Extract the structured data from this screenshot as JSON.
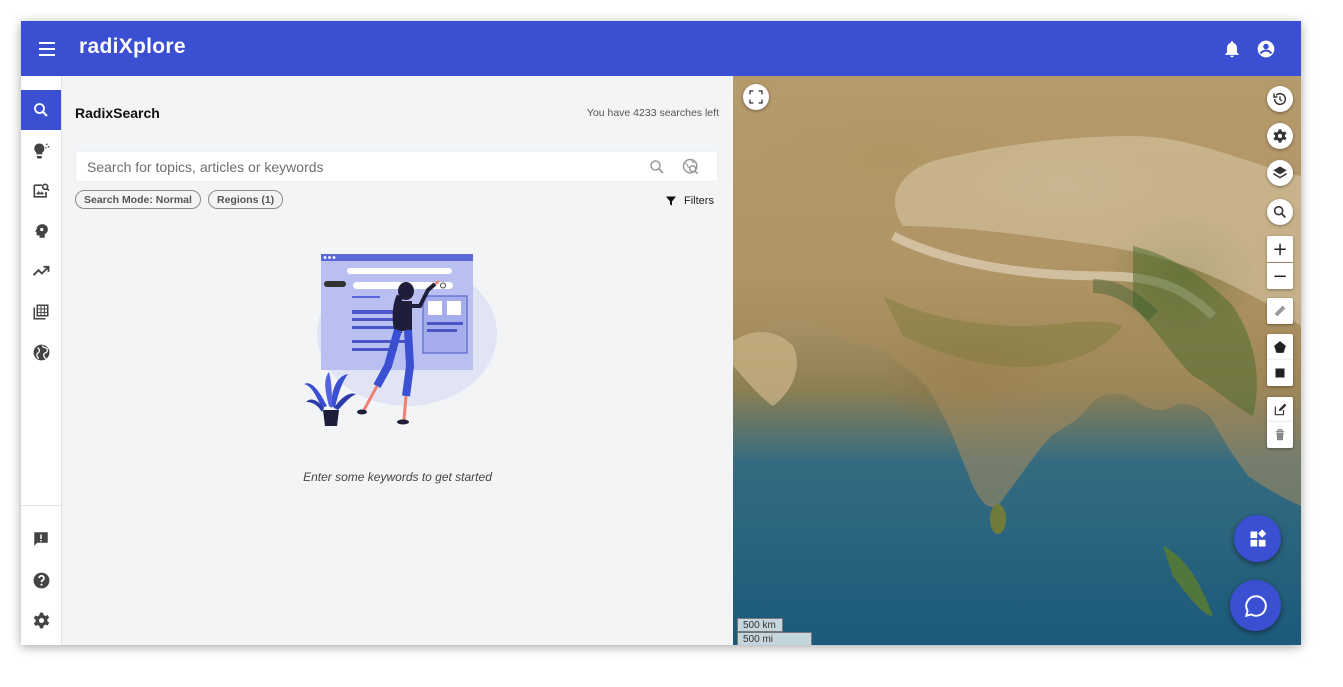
{
  "app": {
    "title": "radiXplore"
  },
  "panel": {
    "title": "RadixSearch",
    "searches_left": "You have 4233 searches left",
    "search": {
      "placeholder": "Search for topics, articles or keywords",
      "value": ""
    },
    "chips": [
      "Search Mode: Normal",
      "Regions (1)"
    ],
    "filters_label": "Filters",
    "empty_state": "Enter some keywords to get started"
  },
  "nav": {
    "items": [
      "search-icon",
      "lightbulb-icon",
      "image-search-icon",
      "psychology-icon",
      "trending-up-icon",
      "table-icon",
      "globe-icon"
    ],
    "bottom": [
      "feedback-icon",
      "help-icon",
      "settings-icon"
    ],
    "active": "search-icon"
  },
  "map": {
    "scale_km": "500 km",
    "scale_mi": "500 mi",
    "zoom_in": "+",
    "zoom_out": "−"
  },
  "colors": {
    "primary": "#3a4fd1",
    "panel_bg": "#f3f4f6"
  }
}
